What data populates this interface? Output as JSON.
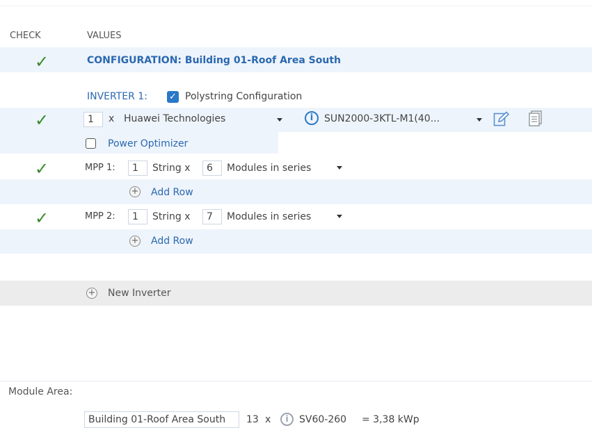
{
  "header": {
    "check_col": "CHECK",
    "values_col": "VALUES"
  },
  "configuration": {
    "title": "CONFIGURATION: Building 01-Roof Area South"
  },
  "inverter": {
    "label": "INVERTER 1:",
    "polystring_label": "Polystring Configuration",
    "polystring_checked": true,
    "quantity": "1",
    "times": "x",
    "manufacturer": "Huawei Technologies",
    "model": "SUN2000-3KTL-M1(40...",
    "power_optimizer_label": "Power Optimizer",
    "power_optimizer_checked": false
  },
  "mpp": [
    {
      "label": "MPP 1:",
      "strings": "1",
      "string_x": "String x",
      "modules": "6",
      "series_label": "Modules in series",
      "add_row": "Add Row"
    },
    {
      "label": "MPP 2:",
      "strings": "1",
      "string_x": "String x",
      "modules": "7",
      "series_label": "Modules in series",
      "add_row": "Add Row"
    }
  ],
  "new_inverter": "New Inverter",
  "module_area": {
    "label": "Module Area:",
    "area_name": "Building 01-Roof Area South",
    "count": "13",
    "times": "x",
    "module": "SV60-260",
    "result": "= 3,38 kWp"
  },
  "icons": {
    "check": "check-icon",
    "edit": "edit-icon",
    "copy": "copy-icon",
    "info": "info-icon",
    "add": "plus-circle-icon"
  },
  "colors": {
    "accent": "#2a78c8",
    "check": "#3a8a2c",
    "band": "#eef4fb",
    "grey_band": "#ececec"
  }
}
